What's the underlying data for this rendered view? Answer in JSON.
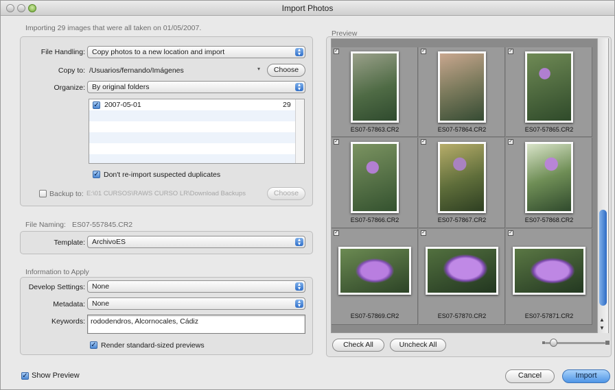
{
  "window": {
    "title": "Import Photos"
  },
  "summary": "Importing 29 images that were all taken on 01/05/2007.",
  "file_handling": {
    "label": "File Handling:",
    "value": "Copy photos to a new location and import",
    "copy_to_label": "Copy to:",
    "copy_to_path": "/Usuarios/fernando/Imágenes",
    "choose_label": "Choose",
    "organize_label": "Organize:",
    "organize_value": "By original folders",
    "folders": [
      {
        "name": "2007-05-01",
        "count": "29",
        "checked": true
      }
    ],
    "dont_reimport_label": "Don't re-import suspected duplicates",
    "backup_label": "Backup to:",
    "backup_path": "E:\\01 CURSOS\\RAWS CURSO LR\\Download Backups",
    "backup_choose_label": "Choose"
  },
  "file_naming": {
    "heading": "File Naming:",
    "example": "ES07-557845.CR2",
    "template_label": "Template:",
    "template_value": "ArchivoES"
  },
  "info_to_apply": {
    "heading": "Information to Apply",
    "develop_label": "Develop Settings:",
    "develop_value": "None",
    "metadata_label": "Metadata:",
    "metadata_value": "None",
    "keywords_label": "Keywords:",
    "keywords_value": "rododendros, Alcornocales, Cádiz",
    "render_previews_label": "Render standard-sized previews"
  },
  "preview": {
    "heading": "Preview",
    "items": [
      "ES07-57863.CR2",
      "ES07-57864.CR2",
      "ES07-57865.CR2",
      "ES07-57866.CR2",
      "ES07-57867.CR2",
      "ES07-57868.CR2",
      "ES07-57869.CR2",
      "ES07-57870.CR2",
      "ES07-57871.CR2"
    ],
    "check_all_label": "Check All",
    "uncheck_all_label": "Uncheck All"
  },
  "footer": {
    "show_preview_label": "Show Preview",
    "cancel_label": "Cancel",
    "import_label": "Import"
  },
  "colors": {
    "accent": "#4f95e6",
    "grid_bg": "#8a8a8a"
  }
}
